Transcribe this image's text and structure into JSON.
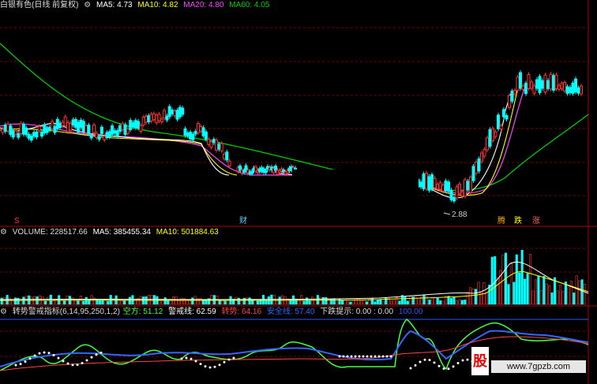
{
  "main_legend": {
    "title": "白银有色(日线 前复权)",
    "ma5": "MA5: 4.73",
    "ma10": "MA10: 4.82",
    "ma20": "MA20: 4.80",
    "ma60": "MA60: 4.05",
    "gear_icon": "circle-gear-icon"
  },
  "price_marks": {
    "low_price": "2.88",
    "event_s": "S",
    "event_cai": "财",
    "event_teng": "腾",
    "event_die": "跌",
    "event_zhang": "涨"
  },
  "volume_legend": {
    "label": "VOLUME: 228517.66",
    "ma5": "MA5: 385455.34",
    "ma10": "MA10: 501884.63"
  },
  "indicator_legend": {
    "name": "转势警戒指标(6,14,95,250,1,2)",
    "kongfang": "空方: 51.12",
    "jingjie": "警戒线: 62.59",
    "zhuanshi": "转势: 64.16",
    "anquan": "安全线: 57.40",
    "xiadie": "下跌提示: 0.00 : 0.00",
    "extra": "100.00"
  },
  "watermark": {
    "site": "www.7gpzb.com",
    "logo_text": "股"
  },
  "colors": {
    "ma5": "#ffffff",
    "ma10": "#ffff00",
    "ma20": "#ff44ff",
    "ma60": "#00cc00",
    "up": "#ff3333",
    "down": "#00ffff",
    "grid": "#7a0000"
  }
}
